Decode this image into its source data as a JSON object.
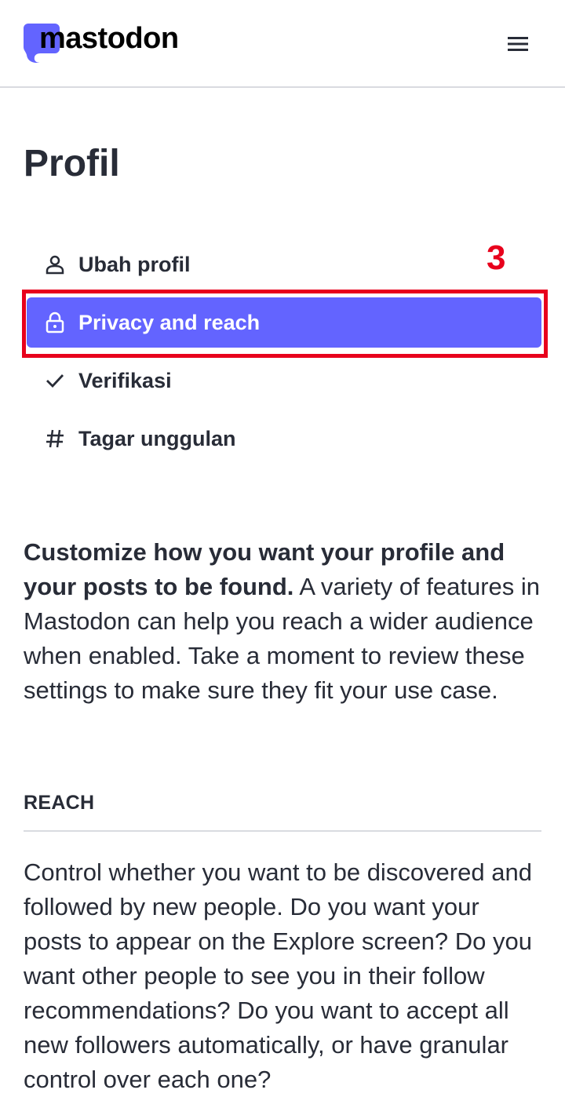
{
  "header": {
    "logo_text": "mastodon",
    "menu_icon": "hamburger-menu-icon",
    "brand_color": "#6364ff"
  },
  "page": {
    "title": "Profil"
  },
  "nav": {
    "items": [
      {
        "label": "Ubah profil",
        "icon": "user-icon",
        "active": false
      },
      {
        "label": "Privacy and reach",
        "icon": "lock-icon",
        "active": true
      },
      {
        "label": "Verifikasi",
        "icon": "check-icon",
        "active": false
      },
      {
        "label": "Tagar unggulan",
        "icon": "hashtag-icon",
        "active": false
      }
    ],
    "active_color": "#6364ff"
  },
  "annotation": {
    "step_number": "3",
    "color": "#e8001c"
  },
  "intro": {
    "bold": "Customize how you want your profile and your posts to be found.",
    "text": " A variety of features in Mastodon can help you reach a wider audience when enabled. Take a moment to review these settings to make sure they fit your use case."
  },
  "reach": {
    "heading": "REACH",
    "text": "Control whether you want to be discovered and followed by new people. Do you want your posts to appear on the Explore screen? Do you want other people to see you in their follow recommendations? Do you want to accept all new followers automatically, or have granular control over each one?"
  }
}
